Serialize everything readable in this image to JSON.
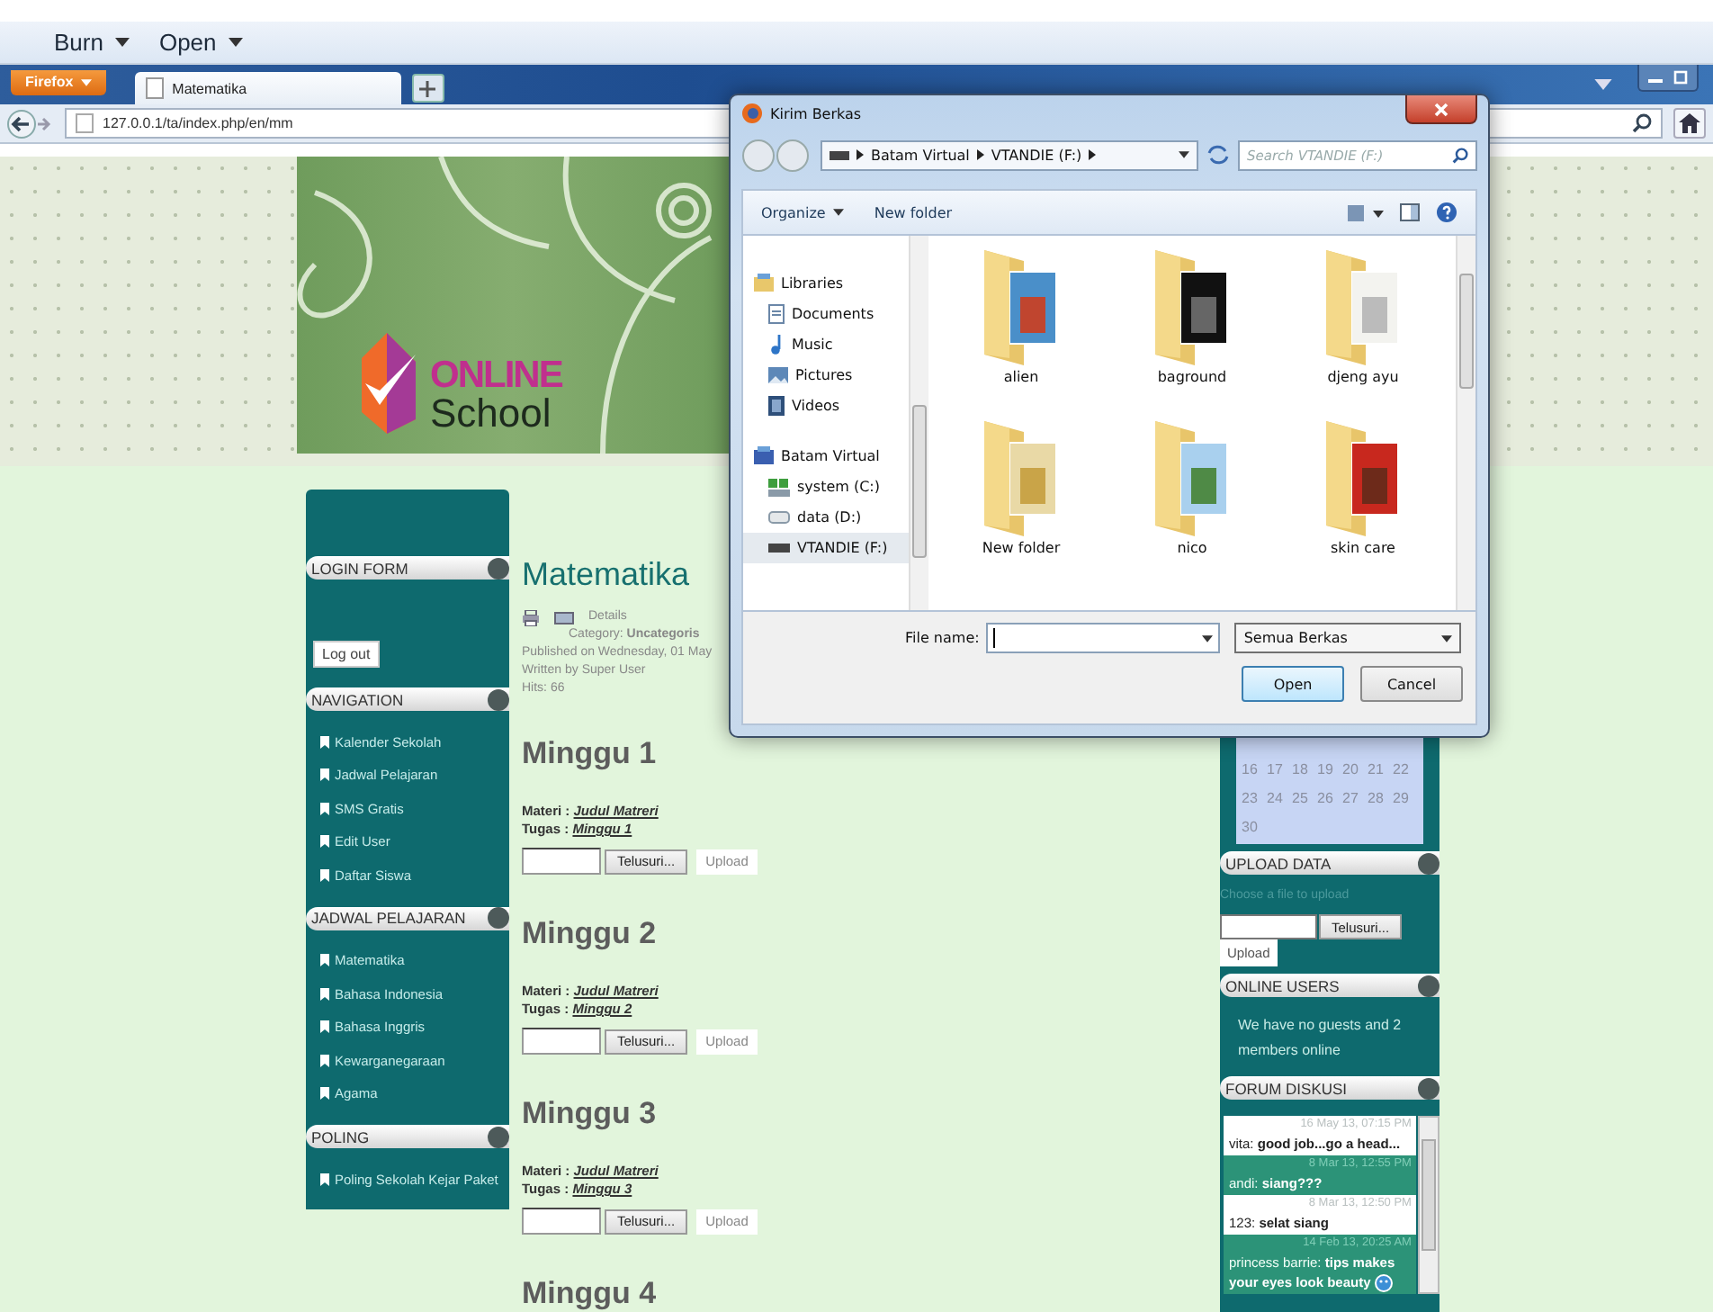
{
  "app_toolbar": {
    "items": [
      {
        "label": "Burn"
      },
      {
        "label": "Open"
      }
    ]
  },
  "browser": {
    "menu_button": "Firefox",
    "tabs": [
      {
        "title": "Matematika",
        "selected": true
      }
    ],
    "url": "127.0.0.1/ta/index.php/en/mm"
  },
  "site_header": {
    "logo_top": "ONLINE",
    "logo_bottom": "School"
  },
  "left_sidebar": {
    "modules": [
      {
        "title": "LOGIN FORM",
        "kind": "login",
        "button": "Log out"
      },
      {
        "title": "NAVIGATION",
        "kind": "menu",
        "items": [
          "Kalender Sekolah",
          "Jadwal Pelajaran",
          "SMS Gratis",
          "Edit User",
          "Daftar Siswa"
        ]
      },
      {
        "title": "JADWAL PELAJARAN",
        "kind": "menu",
        "items": [
          "Matematika",
          "Bahasa Indonesia",
          "Bahasa Inggris",
          "Kewarganegaraan",
          "Agama"
        ]
      },
      {
        "title": "POLING",
        "kind": "menu",
        "items": [
          "Poling Sekolah Kejar Paket"
        ]
      }
    ]
  },
  "article": {
    "title": "Matematika",
    "details_label": "Details",
    "meta": [
      "Category: **Uncategoris**",
      "Published on Wednesday, 01 May",
      "Written by Super User",
      "Hits: 66"
    ],
    "weeks": [
      {
        "heading": "Minggu 1",
        "materi_label": "Materi :",
        "materi_link": "Judul Matreri",
        "tugas_label": "Tugas :",
        "tugas_link": "Minggu 1",
        "browse_button": "Telusuri...",
        "upload_button": "Upload"
      },
      {
        "heading": "Minggu 2",
        "materi_label": "Materi :",
        "materi_link": "Judul Matreri",
        "tugas_label": "Tugas :",
        "tugas_link": "Minggu 2",
        "browse_button": "Telusuri...",
        "upload_button": "Upload"
      },
      {
        "heading": "Minggu 3",
        "materi_label": "Materi :",
        "materi_link": "Judul Matreri",
        "tugas_label": "Tugas :",
        "tugas_link": "Minggu 3",
        "browse_button": "Telusuri...",
        "upload_button": "Upload"
      },
      {
        "heading": "Minggu 4"
      }
    ]
  },
  "right_sidebar": {
    "calendar_rows": [
      [
        "16",
        "17",
        "18",
        "19",
        "20",
        "21",
        "22"
      ],
      [
        "23",
        "24",
        "25",
        "26",
        "27",
        "28",
        "29"
      ],
      [
        "30"
      ]
    ],
    "upload": {
      "title": "UPLOAD DATA",
      "hint": "Choose a file to upload",
      "browse_button": "Telusuri...",
      "upload_button": "Upload"
    },
    "online": {
      "title": "ONLINE USERS",
      "text": "We have no guests and 2 members online"
    },
    "forum": {
      "title": "FORUM DISKUSI",
      "messages": [
        {
          "time": "16 May 13, 07:15 PM",
          "author": "vita:",
          "text": "good job...go a head...",
          "emoticon": false
        },
        {
          "time": "8 Mar 13, 12:55 PM",
          "author": "andi:",
          "text": "siang???",
          "emoticon": false
        },
        {
          "time": "8 Mar 13, 12:50 PM",
          "author": "123:",
          "text": "selat siang",
          "emoticon": false
        },
        {
          "time": "14 Feb 13, 20:25 AM",
          "author": "princess barrie:",
          "text": "tips makes your eyes look beauty",
          "emoticon": true
        }
      ]
    }
  },
  "dialog": {
    "title": "Kirim Berkas",
    "breadcrumb": [
      "Batam Virtual",
      "VTANDIE (F:)"
    ],
    "search_placeholder": "Search VTANDIE (F:)",
    "toolbar": {
      "organize": "Organize",
      "new_folder": "New folder"
    },
    "nav_tree": [
      {
        "label": "Libraries",
        "kind": "library",
        "selected": false,
        "children": [
          {
            "label": "Documents",
            "kind": "documents",
            "selected": false
          },
          {
            "label": "Music",
            "kind": "music",
            "selected": false
          },
          {
            "label": "Pictures",
            "kind": "pictures",
            "selected": false
          },
          {
            "label": "Videos",
            "kind": "videos",
            "selected": false
          }
        ]
      },
      {
        "label": "Batam Virtual",
        "kind": "computer",
        "selected": false,
        "children": [
          {
            "label": "system (C:)",
            "kind": "system_drive",
            "selected": false
          },
          {
            "label": "data (D:)",
            "kind": "disk_drive",
            "selected": false
          },
          {
            "label": "VTANDIE (F:)",
            "kind": "usb_drive",
            "selected": true
          }
        ]
      }
    ],
    "folders": [
      {
        "name": "alien",
        "kind": "photos"
      },
      {
        "name": "baground",
        "kind": "dark"
      },
      {
        "name": "djeng ayu",
        "kind": "papers"
      },
      {
        "name": "New folder",
        "kind": "beige"
      },
      {
        "name": "nico",
        "kind": "sky"
      },
      {
        "name": "skin care",
        "kind": "red"
      }
    ],
    "file_name_label": "File name:",
    "filter": "Semua Berkas",
    "open_button": "Open",
    "cancel_button": "Cancel"
  }
}
